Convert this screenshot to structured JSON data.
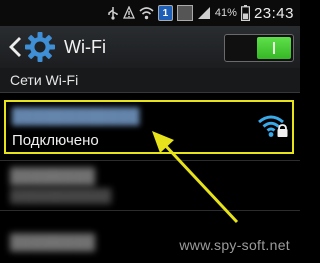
{
  "status_bar": {
    "badge_text": "1",
    "battery_percent": "41%",
    "time": "23:43",
    "icons": [
      "usb-icon",
      "alert-icon",
      "wifi-signal-icon",
      "notification-badge-icon",
      "image-icon",
      "cell-signal-icon",
      "battery-icon"
    ]
  },
  "action_bar": {
    "title": "Wi-Fi",
    "toggle_on": true,
    "accent_color": "#3fc62e"
  },
  "section": {
    "title": "Сети Wi-Fi"
  },
  "connected_network": {
    "status": "Подключено",
    "secured": true,
    "highlight_color": "#e6e21b"
  },
  "watermark": "www.spy-soft.net"
}
